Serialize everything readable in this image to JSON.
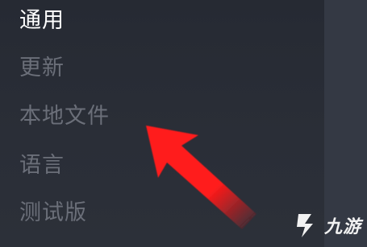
{
  "settings_menu": {
    "items": [
      {
        "label": "通用",
        "active": true
      },
      {
        "label": "更新",
        "active": false
      },
      {
        "label": "本地文件",
        "active": false
      },
      {
        "label": "语言",
        "active": false
      },
      {
        "label": "测试版",
        "active": false
      }
    ]
  },
  "annotation": {
    "icon": "red-arrow-icon",
    "color": "#ff1a1a",
    "points_to": "本地文件"
  },
  "watermark": {
    "text": "九游",
    "icon": "jiuyou-logo-icon"
  },
  "colors": {
    "panel_background": "#2a2e37",
    "active_text": "#ffffff",
    "inactive_text": "#6b6f79"
  }
}
